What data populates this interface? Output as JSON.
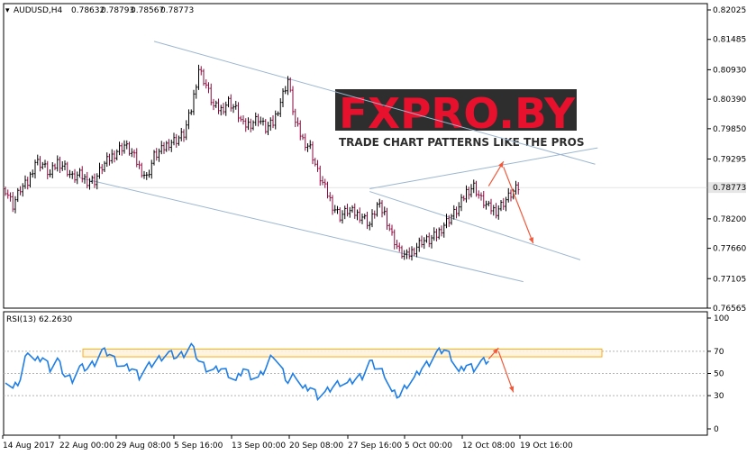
{
  "header": {
    "symbol": "AUDUSD,H4",
    "open": "0.78632",
    "high": "0.78793",
    "low": "0.78567",
    "close": "0.78773"
  },
  "watermark": {
    "brand": "FXPRO.BY",
    "tagline": "TRADE CHART PATTERNS LIKE THE PROS"
  },
  "rsi_header": "RSI(13) 62.2630",
  "current_price_label": "0.78773",
  "colors": {
    "bull_bar": "#000000",
    "bear_bar": "#8b0a3c",
    "channel_line": "#9bb6d0",
    "rsi_line": "#1e7ee6",
    "zone": "#ffa500",
    "arrow": "#f05a3c",
    "price_marker": "#e6e6e6"
  },
  "chart_data": [
    {
      "type": "ohlc",
      "title": "AUDUSD,H4",
      "y_ticks": [
        "0.82025",
        "0.81485",
        "0.80930",
        "0.80390",
        "0.79850",
        "0.79295",
        "0.78200",
        "0.77660",
        "0.77105",
        "0.76565"
      ],
      "ylim": [
        0.76565,
        0.82025
      ],
      "x_ticks": [
        "14 Aug 2017",
        "22 Aug 00:00",
        "29 Aug 08:00",
        "5 Sep 16:00",
        "13 Sep 00:00",
        "20 Sep 08:00",
        "27 Sep 16:00",
        "5 Oct 00:00",
        "12 Oct 08:00",
        "19 Oct 16:00"
      ],
      "close_path": [
        [
          0,
          0.7875
        ],
        [
          3,
          0.7845
        ],
        [
          6,
          0.7875
        ],
        [
          9,
          0.7885
        ],
        [
          12,
          0.7925
        ],
        [
          15,
          0.792
        ],
        [
          18,
          0.79
        ],
        [
          21,
          0.7925
        ],
        [
          24,
          0.7915
        ],
        [
          27,
          0.7895
        ],
        [
          30,
          0.79
        ],
        [
          33,
          0.789
        ],
        [
          36,
          0.789
        ],
        [
          39,
          0.7915
        ],
        [
          42,
          0.793
        ],
        [
          45,
          0.7945
        ],
        [
          48,
          0.7955
        ],
        [
          51,
          0.794
        ],
        [
          54,
          0.7915
        ],
        [
          57,
          0.7895
        ],
        [
          60,
          0.7935
        ],
        [
          63,
          0.7945
        ],
        [
          66,
          0.796
        ],
        [
          69,
          0.7965
        ],
        [
          72,
          0.7975
        ],
        [
          75,
          0.802
        ],
        [
          78,
          0.8095
        ],
        [
          81,
          0.8065
        ],
        [
          84,
          0.8025
        ],
        [
          87,
          0.802
        ],
        [
          90,
          0.8035
        ],
        [
          93,
          0.802
        ],
        [
          96,
          0.799
        ],
        [
          99,
          0.7995
        ],
        [
          102,
          0.8005
        ],
        [
          105,
          0.7985
        ],
        [
          108,
          0.7995
        ],
        [
          111,
          0.8035
        ],
        [
          114,
          0.8075
        ],
        [
          117,
          0.7995
        ],
        [
          120,
          0.7965
        ],
        [
          123,
          0.795
        ],
        [
          126,
          0.7905
        ],
        [
          129,
          0.7875
        ],
        [
          132,
          0.7845
        ],
        [
          135,
          0.7825
        ],
        [
          138,
          0.7835
        ],
        [
          141,
          0.783
        ],
        [
          144,
          0.7825
        ],
        [
          147,
          0.781
        ],
        [
          150,
          0.7845
        ],
        [
          153,
          0.783
        ],
        [
          156,
          0.779
        ],
        [
          159,
          0.776
        ],
        [
          162,
          0.775
        ],
        [
          165,
          0.7765
        ],
        [
          168,
          0.778
        ],
        [
          171,
          0.778
        ],
        [
          174,
          0.779
        ],
        [
          177,
          0.781
        ],
        [
          180,
          0.7825
        ],
        [
          183,
          0.784
        ],
        [
          186,
          0.787
        ],
        [
          189,
          0.788
        ],
        [
          192,
          0.7855
        ],
        [
          195,
          0.784
        ],
        [
          198,
          0.7835
        ],
        [
          201,
          0.785
        ],
        [
          204,
          0.7865
        ],
        [
          207,
          0.7877
        ]
      ],
      "trend_lines": [
        {
          "from": [
            60,
            0.8145
          ],
          "to": [
            238,
            0.792
          ]
        },
        {
          "from": [
            30,
            0.7895
          ],
          "to": [
            209,
            0.7705
          ]
        },
        {
          "from": [
            147,
            0.7875
          ],
          "to": [
            239,
            0.795
          ]
        },
        {
          "from": [
            147,
            0.787
          ],
          "to": [
            232,
            0.7745
          ]
        }
      ],
      "arrows": [
        {
          "from": [
            195,
            0.788
          ],
          "to": [
            201,
            0.7925
          ]
        },
        {
          "from": [
            201,
            0.7915
          ],
          "to": [
            213,
            0.7775
          ]
        }
      ],
      "current_price": 0.78773
    },
    {
      "type": "line",
      "title": "RSI(13) 62.2630",
      "y_ticks": [
        "100",
        "70",
        "50",
        "30",
        "0"
      ],
      "ylim": [
        0,
        100
      ],
      "grid": true,
      "zone": [
        65,
        72
      ],
      "path": [
        [
          0,
          45
        ],
        [
          3,
          35
        ],
        [
          6,
          45
        ],
        [
          9,
          72
        ],
        [
          12,
          60
        ],
        [
          15,
          65
        ],
        [
          18,
          55
        ],
        [
          21,
          62
        ],
        [
          24,
          48
        ],
        [
          27,
          45
        ],
        [
          30,
          55
        ],
        [
          33,
          55
        ],
        [
          36,
          60
        ],
        [
          39,
          70
        ],
        [
          42,
          68
        ],
        [
          45,
          60
        ],
        [
          48,
          55
        ],
        [
          51,
          55
        ],
        [
          54,
          48
        ],
        [
          57,
          55
        ],
        [
          60,
          60
        ],
        [
          63,
          65
        ],
        [
          66,
          68
        ],
        [
          69,
          65
        ],
        [
          72,
          68
        ],
        [
          75,
          75
        ],
        [
          78,
          62
        ],
        [
          81,
          55
        ],
        [
          84,
          52
        ],
        [
          87,
          55
        ],
        [
          90,
          50
        ],
        [
          93,
          42
        ],
        [
          96,
          55
        ],
        [
          99,
          48
        ],
        [
          102,
          45
        ],
        [
          105,
          55
        ],
        [
          108,
          68
        ],
        [
          111,
          55
        ],
        [
          114,
          42
        ],
        [
          117,
          50
        ],
        [
          120,
          35
        ],
        [
          123,
          38
        ],
        [
          126,
          30
        ],
        [
          129,
          32
        ],
        [
          132,
          38
        ],
        [
          135,
          42
        ],
        [
          138,
          40
        ],
        [
          141,
          45
        ],
        [
          144,
          48
        ],
        [
          147,
          60
        ],
        [
          150,
          55
        ],
        [
          153,
          50
        ],
        [
          156,
          32
        ],
        [
          159,
          30
        ],
        [
          162,
          40
        ],
        [
          165,
          45
        ],
        [
          168,
          55
        ],
        [
          171,
          60
        ],
        [
          174,
          68
        ],
        [
          177,
          72
        ],
        [
          180,
          65
        ],
        [
          183,
          50
        ],
        [
          186,
          58
        ],
        [
          189,
          55
        ],
        [
          192,
          60
        ],
        [
          195,
          62
        ]
      ],
      "arrows": [
        {
          "from": [
            195,
            63
          ],
          "to": [
            199,
            73
          ]
        },
        {
          "from": [
            199,
            70
          ],
          "to": [
            205,
            33
          ]
        }
      ]
    }
  ]
}
